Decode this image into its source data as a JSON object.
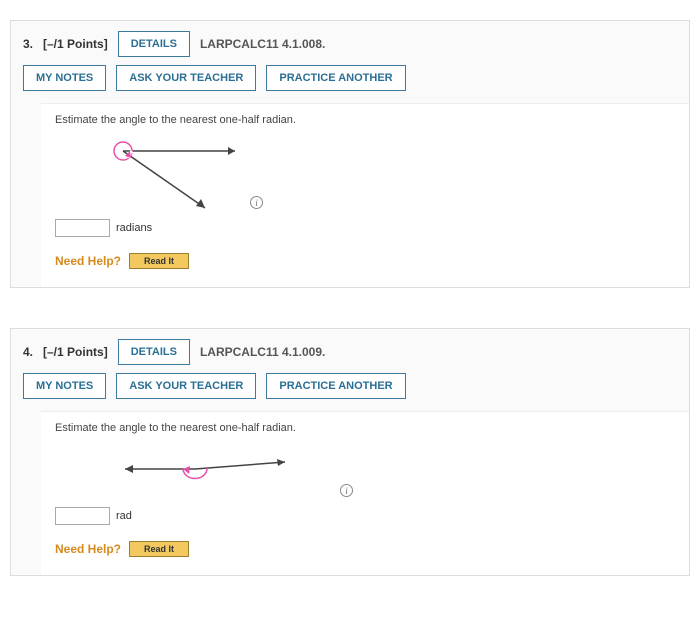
{
  "questions": [
    {
      "number": "3.",
      "points": "[–/1 Points]",
      "details_label": "DETAILS",
      "source": "LARPCALC11 4.1.008.",
      "buttons": {
        "notes": "MY NOTES",
        "ask": "ASK YOUR TEACHER",
        "practice": "PRACTICE ANOTHER"
      },
      "prompt": "Estimate the angle to the nearest one-half radian.",
      "unit": "radians",
      "need_help": "Need Help?",
      "read_it": "Read It"
    },
    {
      "number": "4.",
      "points": "[–/1 Points]",
      "details_label": "DETAILS",
      "source": "LARPCALC11 4.1.009.",
      "buttons": {
        "notes": "MY NOTES",
        "ask": "ASK YOUR TEACHER",
        "practice": "PRACTICE ANOTHER"
      },
      "prompt": "Estimate the angle to the nearest one-half radian.",
      "unit": "rad",
      "need_help": "Need Help?",
      "read_it": "Read It"
    }
  ]
}
